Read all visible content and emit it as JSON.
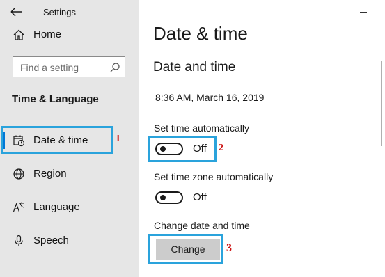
{
  "app": {
    "title": "Settings"
  },
  "sidebar": {
    "home_label": "Home",
    "search_placeholder": "Find a setting",
    "section_heading": "Time & Language",
    "items": [
      {
        "label": "Date & time",
        "icon": "calendar-clock-icon",
        "selected": true
      },
      {
        "label": "Region",
        "icon": "globe-icon",
        "selected": false
      },
      {
        "label": "Language",
        "icon": "language-icon",
        "selected": false
      },
      {
        "label": "Speech",
        "icon": "microphone-icon",
        "selected": false
      }
    ]
  },
  "main": {
    "page_title": "Date & time",
    "section_title": "Date and time",
    "current_datetime": "8:36 AM, March 16, 2019",
    "set_time_auto": {
      "label": "Set time automatically",
      "state": "Off"
    },
    "set_timezone_auto": {
      "label": "Set time zone automatically",
      "state": "Off"
    },
    "change_section_label": "Change date and time",
    "change_button_label": "Change"
  },
  "annotations": {
    "callout_1": "1",
    "callout_2": "2",
    "callout_3": "3"
  },
  "colors": {
    "accent": "#0078d7",
    "highlight_box": "#2aa3dc",
    "callout_text": "#cc1111",
    "sidebar_bg": "#e6e6e6"
  }
}
